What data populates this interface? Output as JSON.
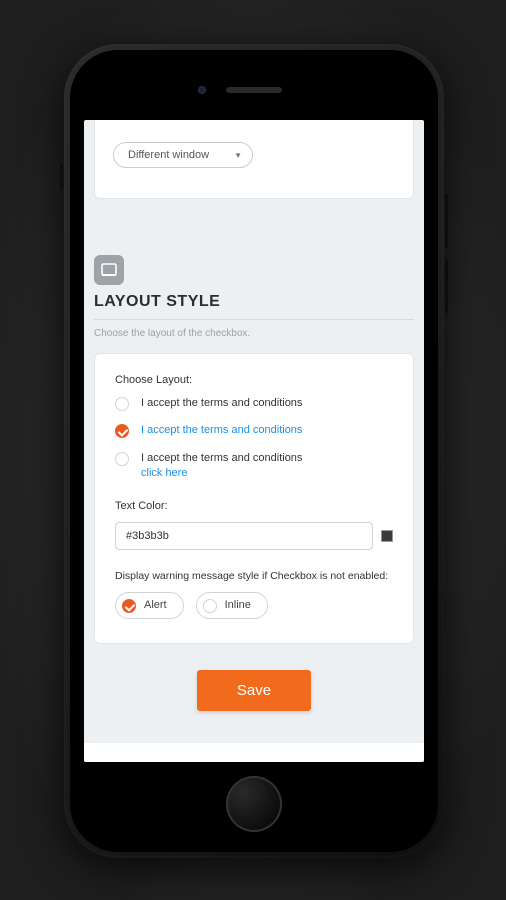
{
  "top_select": {
    "value": "Different window"
  },
  "section": {
    "title": "LAYOUT STYLE",
    "subtitle": "Choose the layout of the checkbox."
  },
  "choose_layout": {
    "label": "Choose Layout:",
    "options": [
      {
        "text": "I accept the terms and conditions",
        "link": false,
        "selected": false
      },
      {
        "text": "I accept the terms and conditions",
        "link": true,
        "selected": true
      },
      {
        "text": "I accept the terms and conditions",
        "sublink": "click here",
        "link": false,
        "selected": false
      }
    ]
  },
  "text_color": {
    "label": "Text Color:",
    "value": "#3b3b3b"
  },
  "warning": {
    "label": "Display warning message style if Checkbox is not enabled:",
    "options": [
      {
        "text": "Alert",
        "selected": true
      },
      {
        "text": "Inline",
        "selected": false
      }
    ]
  },
  "save_label": "Save",
  "colors": {
    "accent": "#f26a1b",
    "radio_checked": "#ec5a24",
    "link": "#1a8fe3",
    "swatch": "#3b3b3b"
  }
}
